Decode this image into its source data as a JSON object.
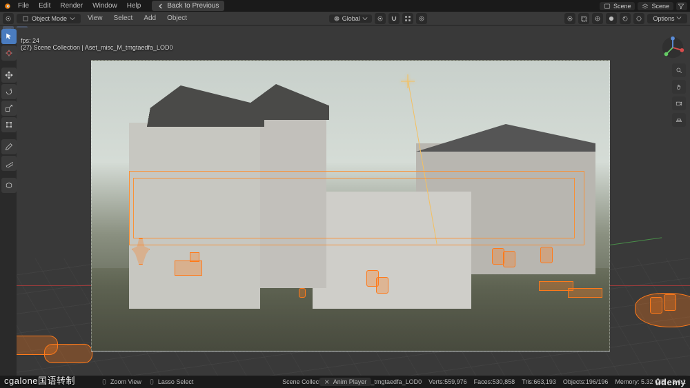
{
  "menu": {
    "items": [
      "File",
      "Edit",
      "Render",
      "Window",
      "Help"
    ],
    "back_label": "Back to Previous"
  },
  "scene_selectors": {
    "left": "Scene",
    "right": "Scene"
  },
  "header2": {
    "mode_label": "Object Mode",
    "sub_items": [
      "View",
      "Select",
      "Add",
      "Object"
    ],
    "orientation": "Global",
    "options_label": "Options"
  },
  "overlay": {
    "fps": "fps: 24",
    "path": "(27) Scene Collection | Aset_misc_M_tmgtaedfa_LOD0"
  },
  "toolbar": {
    "tools": [
      "select-box",
      "cursor",
      "move",
      "rotate",
      "scale",
      "transform",
      "annotate",
      "measure",
      "add-primitive"
    ]
  },
  "status": {
    "left_items": [
      "Zoom View",
      "Lasso Select"
    ],
    "center": "Anim Player",
    "collection": "Scene Collection | Aset_misc_M_tmgtaedfa_LOD0",
    "stats": {
      "verts": "Verts:559,976",
      "faces": "Faces:530,858",
      "tris": "Tris:663,193",
      "objects": "Objects:196/196",
      "memory": "Memory: 5.32 GiB"
    },
    "version_badge": "3.4.1"
  },
  "watermarks": {
    "left": "cgalone国语转制",
    "right": "ûdemy"
  }
}
